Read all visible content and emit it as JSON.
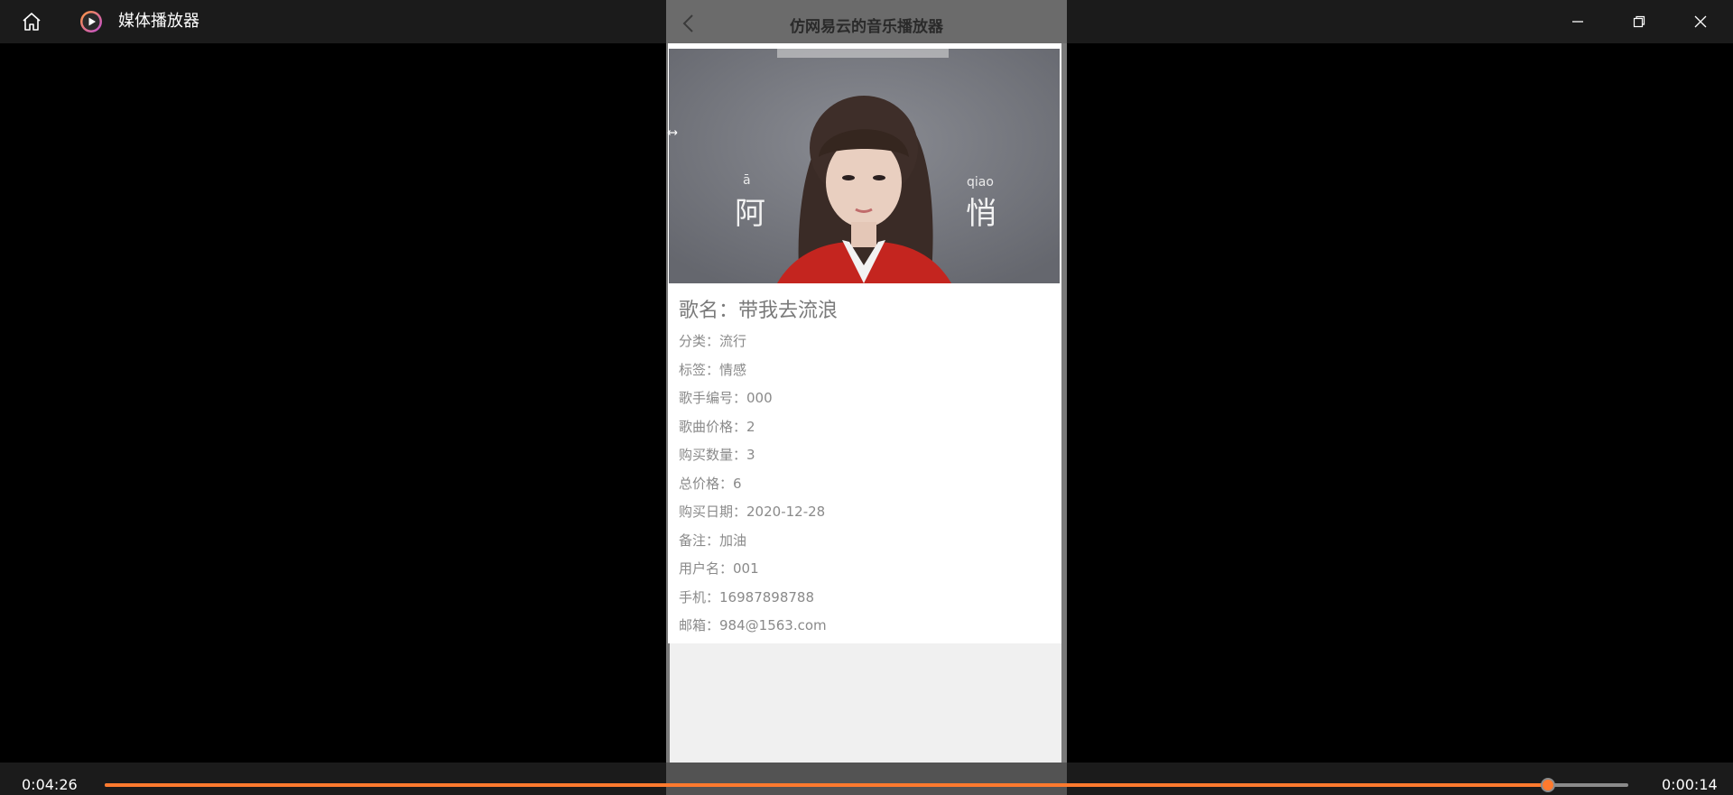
{
  "window": {
    "title": "媒体播放器",
    "icons": {
      "home": "home-icon",
      "app": "play-circle-icon",
      "minimize": "minimize-icon",
      "maximize": "restore-icon",
      "close": "close-icon"
    }
  },
  "app": {
    "header_title": "仿网易云的音乐播放器",
    "back_icon": "chevron-left-icon",
    "cover": {
      "left_char": "阿",
      "left_pinyin": "ā",
      "right_char": "悄",
      "right_pinyin": "qiao"
    },
    "song": {
      "label": "歌名：",
      "value": "带我去流浪"
    },
    "details": [
      {
        "label": "分类：",
        "value": "流行"
      },
      {
        "label": "标签：",
        "value": "情感"
      },
      {
        "label": "歌手编号：",
        "value": "000"
      },
      {
        "label": "歌曲价格：",
        "value": "2"
      },
      {
        "label": "购买数量：",
        "value": "3"
      },
      {
        "label": "总价格：",
        "value": "6"
      },
      {
        "label": "购买日期：",
        "value": "2020-12-28"
      },
      {
        "label": "备注：",
        "value": "加油"
      },
      {
        "label": "用户名：",
        "value": "001"
      },
      {
        "label": "手机：",
        "value": "16987898788"
      },
      {
        "label": "邮箱：",
        "value": "984@1563.com"
      }
    ]
  },
  "player": {
    "elapsed": "0:04:26",
    "remaining": "0:00:14",
    "progress": 0.9475,
    "accent_color": "#ff7a2e"
  }
}
